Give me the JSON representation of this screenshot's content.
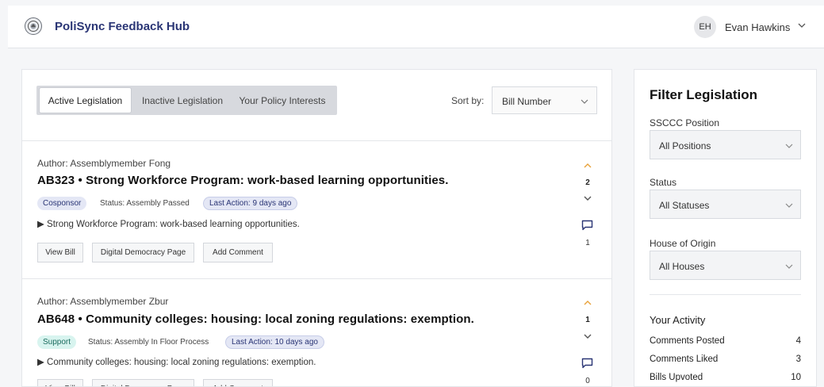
{
  "header": {
    "app_title": "PoliSync Feedback Hub",
    "user_initials": "EH",
    "user_name": "Evan Hawkins"
  },
  "tabs": [
    {
      "label": "Active Legislation",
      "active": true
    },
    {
      "label": "Inactive Legislation",
      "active": false
    },
    {
      "label": "Your Policy Interests",
      "active": false
    }
  ],
  "sort": {
    "label": "Sort by:",
    "value": "Bill Number"
  },
  "bills": [
    {
      "author": "Author: Assemblymember Fong",
      "title": "AB323 • Strong Workforce Program: work-based learning opportunities.",
      "role": "Cosponsor",
      "status": "Status: Assembly Passed",
      "last_action": "Last Action: 9 days ago",
      "summary": "▶ Strong Workforce Program: work-based learning opportunities.",
      "buttons": [
        "View Bill",
        "Digital Democracy Page",
        "Add Comment"
      ],
      "votes": "2",
      "comments": "1"
    },
    {
      "author": "Author: Assemblymember Zbur",
      "title": "AB648 • Community colleges: housing: local zoning regulations: exemption.",
      "role": "Support",
      "status": "Status: Assembly In Floor Process",
      "last_action": "Last Action: 10 days ago",
      "summary": "▶ Community colleges: housing: local zoning regulations: exemption.",
      "buttons": [
        "View Bill",
        "Digital Democracy Page",
        "Add Comment"
      ],
      "votes": "1",
      "comments": "0"
    }
  ],
  "filters": {
    "title": "Filter Legislation",
    "fields": [
      {
        "label": "SSCCC Position",
        "value": "All Positions"
      },
      {
        "label": "Status",
        "value": "All Statuses"
      },
      {
        "label": "House of Origin",
        "value": "All Houses"
      }
    ]
  },
  "activity": {
    "title": "Your Activity",
    "rows": [
      {
        "label": "Comments Posted",
        "value": "4"
      },
      {
        "label": "Comments Liked",
        "value": "3"
      },
      {
        "label": "Bills Upvoted",
        "value": "10"
      }
    ]
  },
  "colors": {
    "brand": "#2a3575",
    "upvote": "#e8a13a",
    "support_tag": "#d8f4ef",
    "cosponsor_tag": "#e4e7f5"
  }
}
